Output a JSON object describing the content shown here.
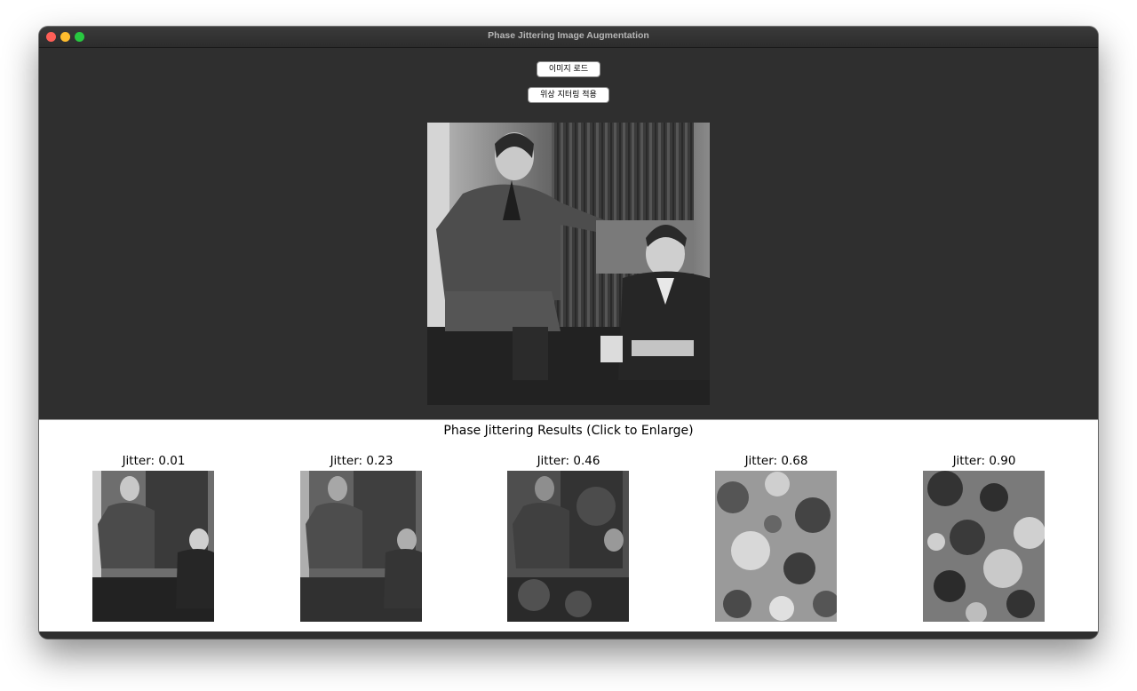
{
  "window": {
    "title": "Phase Jittering Image Augmentation"
  },
  "toolbar": {
    "load_label": "이미지 로드",
    "apply_label": "위상 지터링 적용"
  },
  "results": {
    "title": "Phase Jittering Results (Click to Enlarge)",
    "items": [
      {
        "label": "Jitter: 0.01"
      },
      {
        "label": "Jitter: 0.23"
      },
      {
        "label": "Jitter: 0.46"
      },
      {
        "label": "Jitter: 0.68"
      },
      {
        "label": "Jitter: 0.90"
      }
    ]
  },
  "colors": {
    "window_bg": "#2f2f2f",
    "results_bg": "#ffffff",
    "close": "#ff5f57",
    "minimize": "#febc2e",
    "maximize": "#28c840"
  }
}
